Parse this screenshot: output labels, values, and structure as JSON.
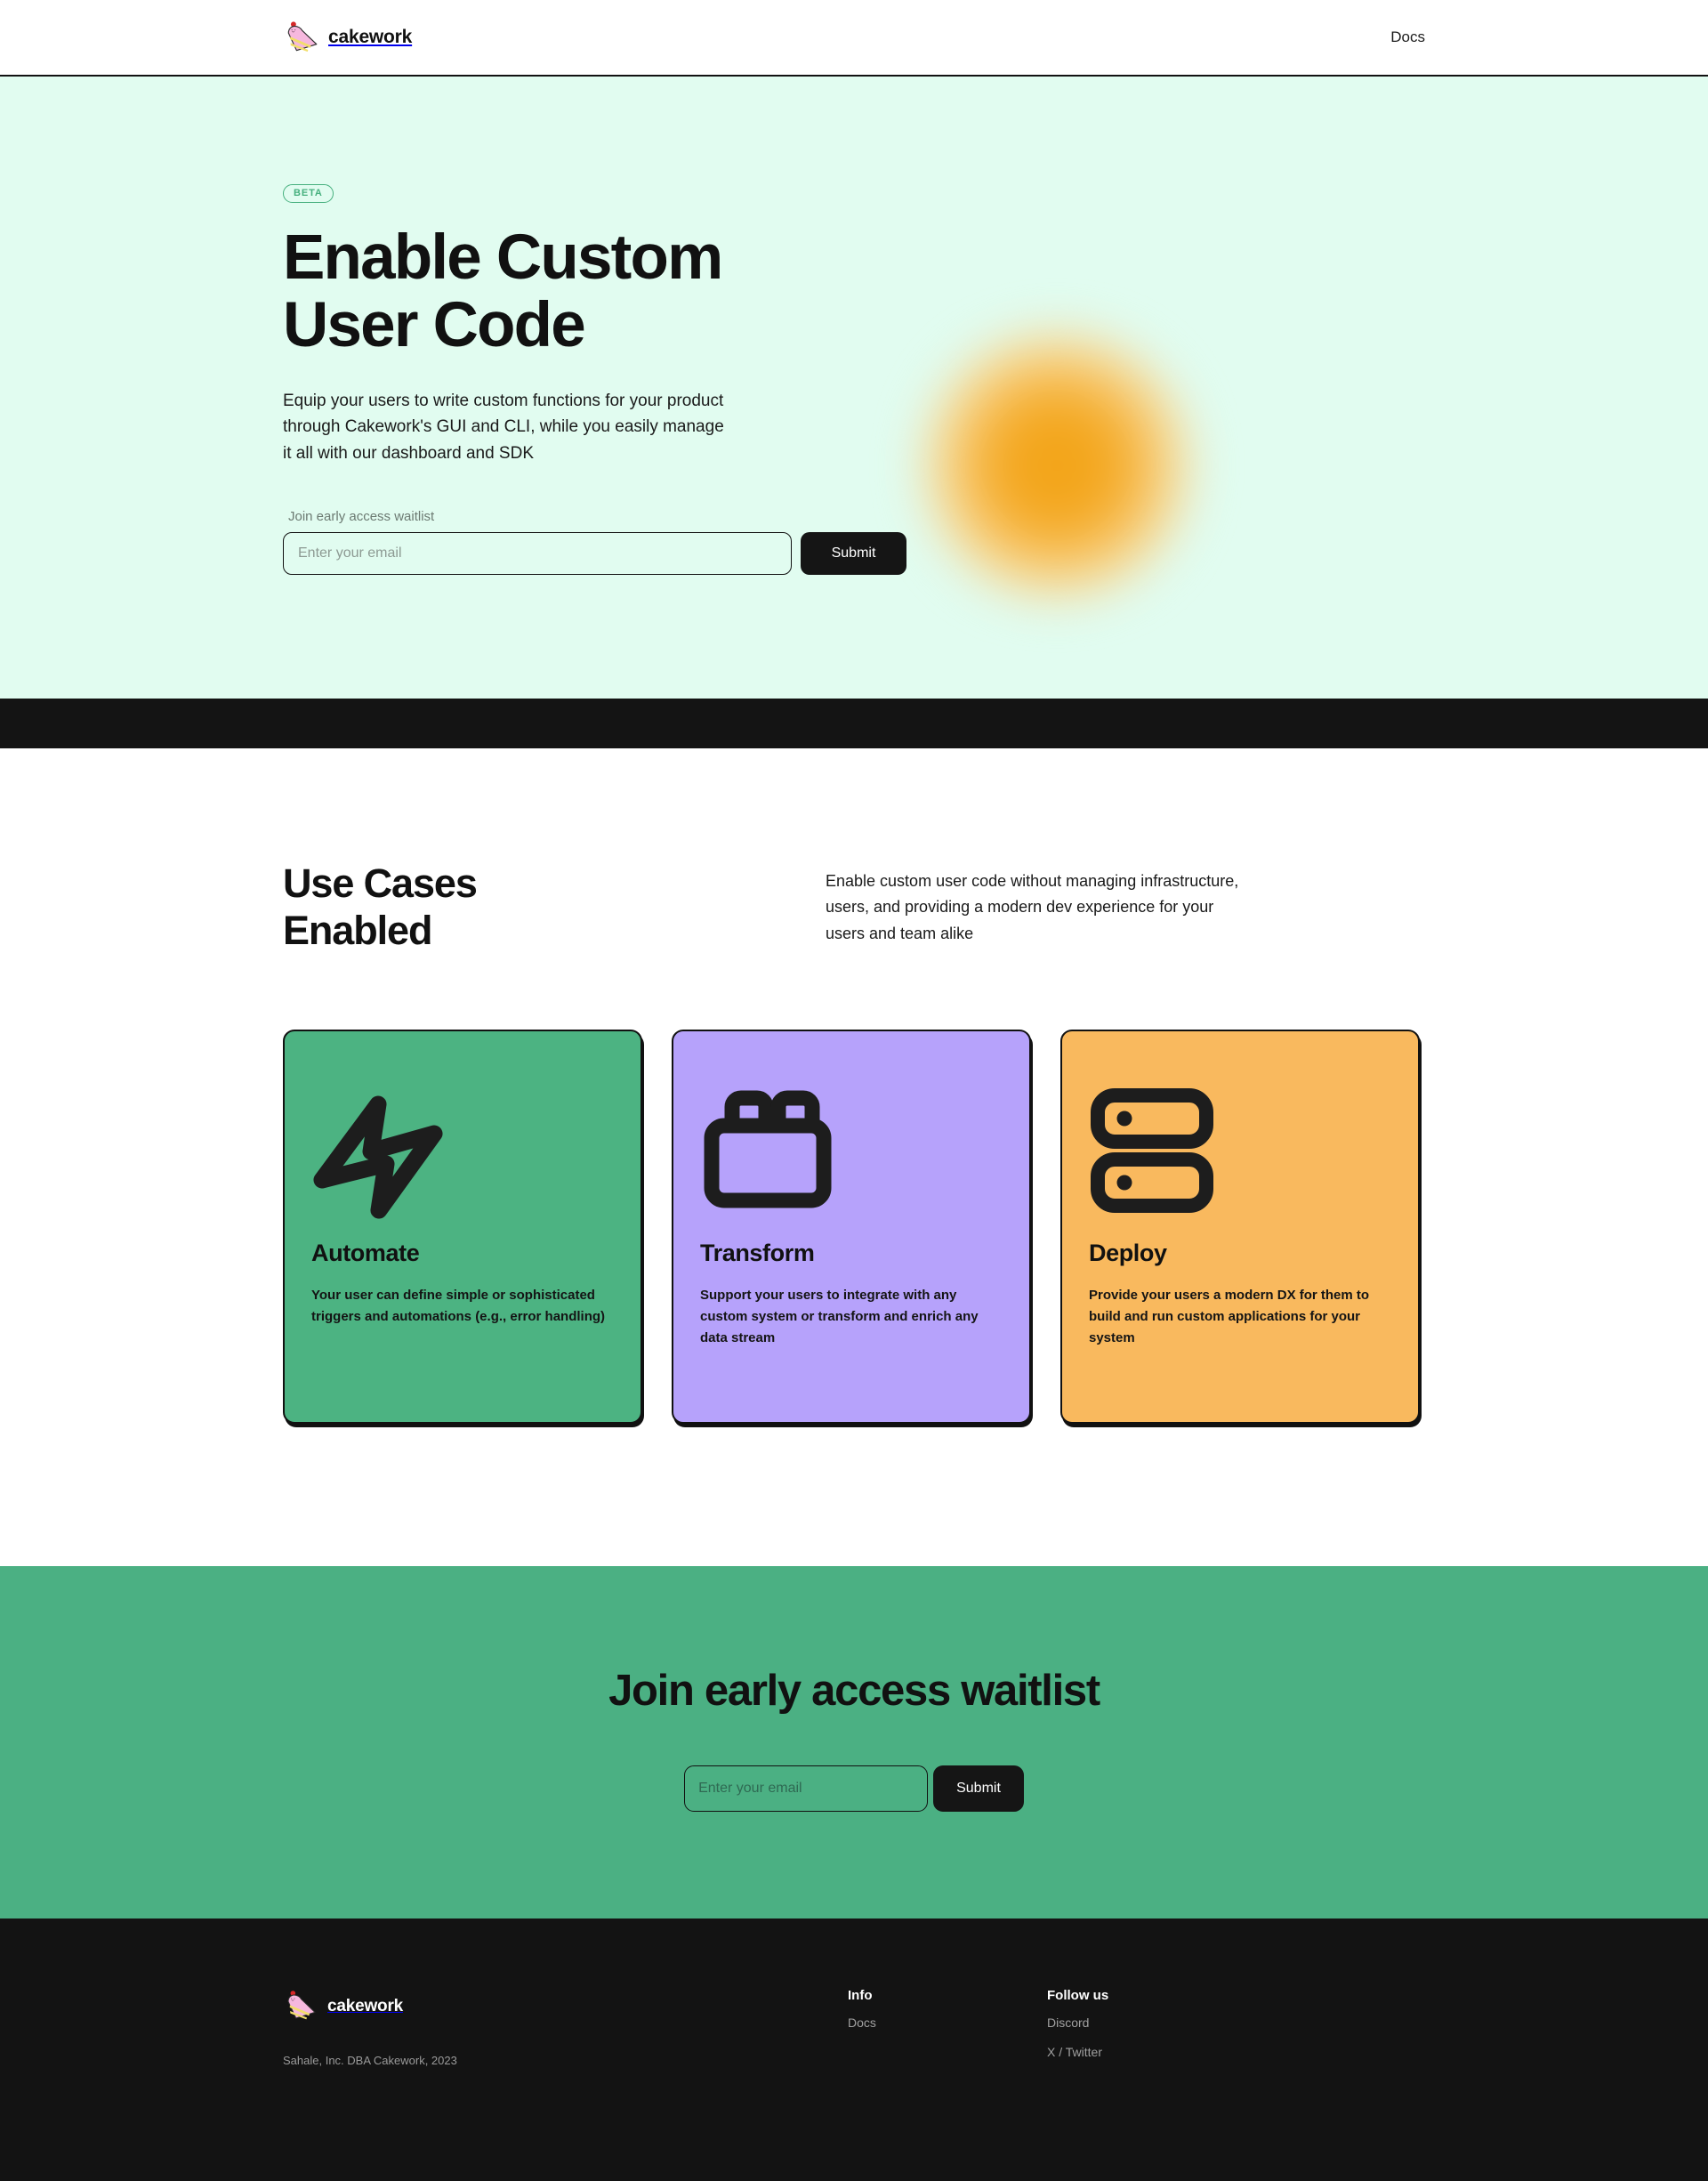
{
  "nav": {
    "brand": "cakework",
    "brand_icon": "cake-slice-icon",
    "links": [
      {
        "label": "Docs"
      }
    ]
  },
  "hero": {
    "badge": "BETA",
    "title_line1": "Enable Custom",
    "title_line2": "User Code",
    "subtitle": "Equip your users to write custom functions for your product through Cakework's GUI and CLI, while you easily manage it all with our dashboard and SDK",
    "form": {
      "label": "Join early access waitlist",
      "placeholder": "Enter your email",
      "value": "",
      "submit_label": "Submit"
    },
    "background_color": "#E1FCF0",
    "orb_color": "#F3A51A"
  },
  "usecases": {
    "title_line1": "Use Cases",
    "title_line2": "Enabled",
    "description": "Enable custom user code without managing infrastructure, users, and providing a modern dev experience for your users and team alike",
    "cards": [
      {
        "title": "Automate",
        "body": "Your user can define simple or sophisticated triggers and automations (e.g., error handling)",
        "color": "#4CB382",
        "icon": "lightning-bolt-icon"
      },
      {
        "title": "Transform",
        "body": "Support your users to integrate with any custom system or transform and enrich any data stream",
        "color": "#B6A2FB",
        "icon": "lego-brick-icon"
      },
      {
        "title": "Deploy",
        "body": "Provide your users a modern DX for them to build and run custom applications for your system",
        "color": "#F9B95E",
        "icon": "server-rack-icon"
      }
    ]
  },
  "cta": {
    "title": "Join early access waitlist",
    "placeholder": "Enter your email",
    "value": "",
    "submit_label": "Submit",
    "background_color": "#4BB083"
  },
  "footer": {
    "brand": "cakework",
    "copyright": "Sahale, Inc. DBA Cakework, 2023",
    "columns": [
      {
        "title": "Info",
        "links": [
          {
            "label": "Docs"
          }
        ]
      },
      {
        "title": "Follow us",
        "links": [
          {
            "label": "Discord"
          },
          {
            "label": "X / Twitter"
          }
        ]
      }
    ],
    "background_color": "#131313"
  }
}
